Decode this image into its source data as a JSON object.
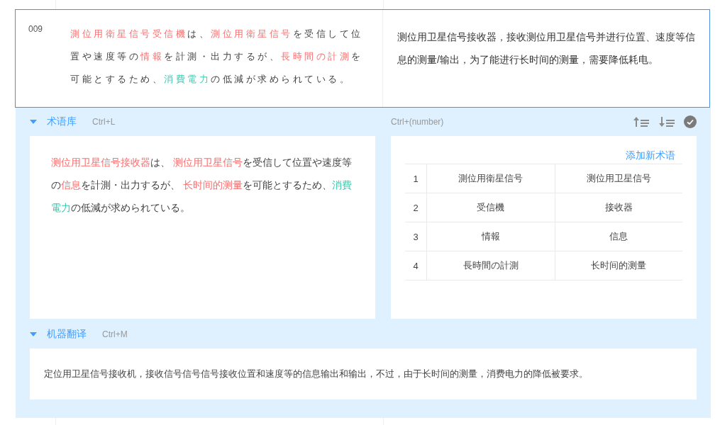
{
  "segment": {
    "id": "009",
    "source": [
      {
        "text": "測位用衛星信号受信機",
        "color": "#f76f6f"
      },
      {
        "text": "は、"
      },
      {
        "text": "測位用衛星信号",
        "color": "#f76f6f"
      },
      {
        "text": "を受信して位置や速度等の"
      },
      {
        "text": "情報",
        "color": "#f76f6f"
      },
      {
        "text": "を計測・出力するが、"
      },
      {
        "text": "長時間の計測",
        "color": "#f76f6f"
      },
      {
        "text": "を可能とするため、"
      },
      {
        "text": "消費電力",
        "color": "#3ccbb0"
      },
      {
        "text": "の低減が求められている。"
      }
    ],
    "target": "测位用卫星信号接收器，接收测位用卫星信号并进行位置、速度等信息的测量/输出，为了能进行长时间的测量，需要降低耗电。"
  },
  "glossary": {
    "title": "术语库",
    "shortcut": "Ctrl+L",
    "expanded": true,
    "number_shortcut": "Ctrl+(number)",
    "source": [
      {
        "text": "测位用卫星信号接收器",
        "color": "#f76f6f"
      },
      {
        "text": "は、 "
      },
      {
        "text": "测位用卫星信号",
        "color": "#f76f6f"
      },
      {
        "text": "を受信して位置や速度等の"
      },
      {
        "text": "信息",
        "color": "#f76f6f"
      },
      {
        "text": "を計測・出力するが、 "
      },
      {
        "text": "长时间的测量",
        "color": "#f76f6f"
      },
      {
        "text": "を可能とするため、"
      },
      {
        "text": "消費電力",
        "color": "#3ccbb0"
      },
      {
        "text": "の低減が求められている。"
      }
    ],
    "add_link": "添加新术语",
    "terms": [
      {
        "index": "1",
        "source": "測位用衛星信号",
        "target": "测位用卫星信号"
      },
      {
        "index": "2",
        "source": "受信機",
        "target": "接收器"
      },
      {
        "index": "3",
        "source": "情報",
        "target": "信息"
      },
      {
        "index": "4",
        "source": "長時間の計測",
        "target": "长时间的测量"
      }
    ]
  },
  "machine_translation": {
    "title": "机器翻译",
    "shortcut": "Ctrl+M",
    "expanded": true,
    "text": "定位用卫星信号接收机，接收信号信号信号接收位置和速度等的信息输出和输出，不过，由于长时间的测量，消费电力的降低被要求。"
  }
}
